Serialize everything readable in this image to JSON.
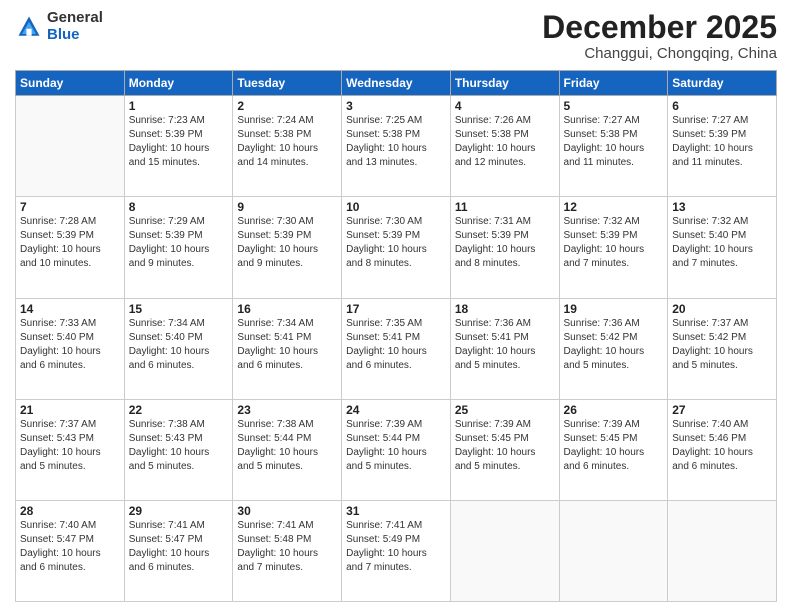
{
  "logo": {
    "general": "General",
    "blue": "Blue"
  },
  "header": {
    "month": "December 2025",
    "location": "Changgui, Chongqing, China"
  },
  "weekdays": [
    "Sunday",
    "Monday",
    "Tuesday",
    "Wednesday",
    "Thursday",
    "Friday",
    "Saturday"
  ],
  "weeks": [
    [
      {
        "day": "",
        "info": ""
      },
      {
        "day": "1",
        "info": "Sunrise: 7:23 AM\nSunset: 5:39 PM\nDaylight: 10 hours\nand 15 minutes."
      },
      {
        "day": "2",
        "info": "Sunrise: 7:24 AM\nSunset: 5:38 PM\nDaylight: 10 hours\nand 14 minutes."
      },
      {
        "day": "3",
        "info": "Sunrise: 7:25 AM\nSunset: 5:38 PM\nDaylight: 10 hours\nand 13 minutes."
      },
      {
        "day": "4",
        "info": "Sunrise: 7:26 AM\nSunset: 5:38 PM\nDaylight: 10 hours\nand 12 minutes."
      },
      {
        "day": "5",
        "info": "Sunrise: 7:27 AM\nSunset: 5:38 PM\nDaylight: 10 hours\nand 11 minutes."
      },
      {
        "day": "6",
        "info": "Sunrise: 7:27 AM\nSunset: 5:39 PM\nDaylight: 10 hours\nand 11 minutes."
      }
    ],
    [
      {
        "day": "7",
        "info": "Sunrise: 7:28 AM\nSunset: 5:39 PM\nDaylight: 10 hours\nand 10 minutes."
      },
      {
        "day": "8",
        "info": "Sunrise: 7:29 AM\nSunset: 5:39 PM\nDaylight: 10 hours\nand 9 minutes."
      },
      {
        "day": "9",
        "info": "Sunrise: 7:30 AM\nSunset: 5:39 PM\nDaylight: 10 hours\nand 9 minutes."
      },
      {
        "day": "10",
        "info": "Sunrise: 7:30 AM\nSunset: 5:39 PM\nDaylight: 10 hours\nand 8 minutes."
      },
      {
        "day": "11",
        "info": "Sunrise: 7:31 AM\nSunset: 5:39 PM\nDaylight: 10 hours\nand 8 minutes."
      },
      {
        "day": "12",
        "info": "Sunrise: 7:32 AM\nSunset: 5:39 PM\nDaylight: 10 hours\nand 7 minutes."
      },
      {
        "day": "13",
        "info": "Sunrise: 7:32 AM\nSunset: 5:40 PM\nDaylight: 10 hours\nand 7 minutes."
      }
    ],
    [
      {
        "day": "14",
        "info": "Sunrise: 7:33 AM\nSunset: 5:40 PM\nDaylight: 10 hours\nand 6 minutes."
      },
      {
        "day": "15",
        "info": "Sunrise: 7:34 AM\nSunset: 5:40 PM\nDaylight: 10 hours\nand 6 minutes."
      },
      {
        "day": "16",
        "info": "Sunrise: 7:34 AM\nSunset: 5:41 PM\nDaylight: 10 hours\nand 6 minutes."
      },
      {
        "day": "17",
        "info": "Sunrise: 7:35 AM\nSunset: 5:41 PM\nDaylight: 10 hours\nand 6 minutes."
      },
      {
        "day": "18",
        "info": "Sunrise: 7:36 AM\nSunset: 5:41 PM\nDaylight: 10 hours\nand 5 minutes."
      },
      {
        "day": "19",
        "info": "Sunrise: 7:36 AM\nSunset: 5:42 PM\nDaylight: 10 hours\nand 5 minutes."
      },
      {
        "day": "20",
        "info": "Sunrise: 7:37 AM\nSunset: 5:42 PM\nDaylight: 10 hours\nand 5 minutes."
      }
    ],
    [
      {
        "day": "21",
        "info": "Sunrise: 7:37 AM\nSunset: 5:43 PM\nDaylight: 10 hours\nand 5 minutes."
      },
      {
        "day": "22",
        "info": "Sunrise: 7:38 AM\nSunset: 5:43 PM\nDaylight: 10 hours\nand 5 minutes."
      },
      {
        "day": "23",
        "info": "Sunrise: 7:38 AM\nSunset: 5:44 PM\nDaylight: 10 hours\nand 5 minutes."
      },
      {
        "day": "24",
        "info": "Sunrise: 7:39 AM\nSunset: 5:44 PM\nDaylight: 10 hours\nand 5 minutes."
      },
      {
        "day": "25",
        "info": "Sunrise: 7:39 AM\nSunset: 5:45 PM\nDaylight: 10 hours\nand 5 minutes."
      },
      {
        "day": "26",
        "info": "Sunrise: 7:39 AM\nSunset: 5:45 PM\nDaylight: 10 hours\nand 6 minutes."
      },
      {
        "day": "27",
        "info": "Sunrise: 7:40 AM\nSunset: 5:46 PM\nDaylight: 10 hours\nand 6 minutes."
      }
    ],
    [
      {
        "day": "28",
        "info": "Sunrise: 7:40 AM\nSunset: 5:47 PM\nDaylight: 10 hours\nand 6 minutes."
      },
      {
        "day": "29",
        "info": "Sunrise: 7:41 AM\nSunset: 5:47 PM\nDaylight: 10 hours\nand 6 minutes."
      },
      {
        "day": "30",
        "info": "Sunrise: 7:41 AM\nSunset: 5:48 PM\nDaylight: 10 hours\nand 7 minutes."
      },
      {
        "day": "31",
        "info": "Sunrise: 7:41 AM\nSunset: 5:49 PM\nDaylight: 10 hours\nand 7 minutes."
      },
      {
        "day": "",
        "info": ""
      },
      {
        "day": "",
        "info": ""
      },
      {
        "day": "",
        "info": ""
      }
    ]
  ]
}
